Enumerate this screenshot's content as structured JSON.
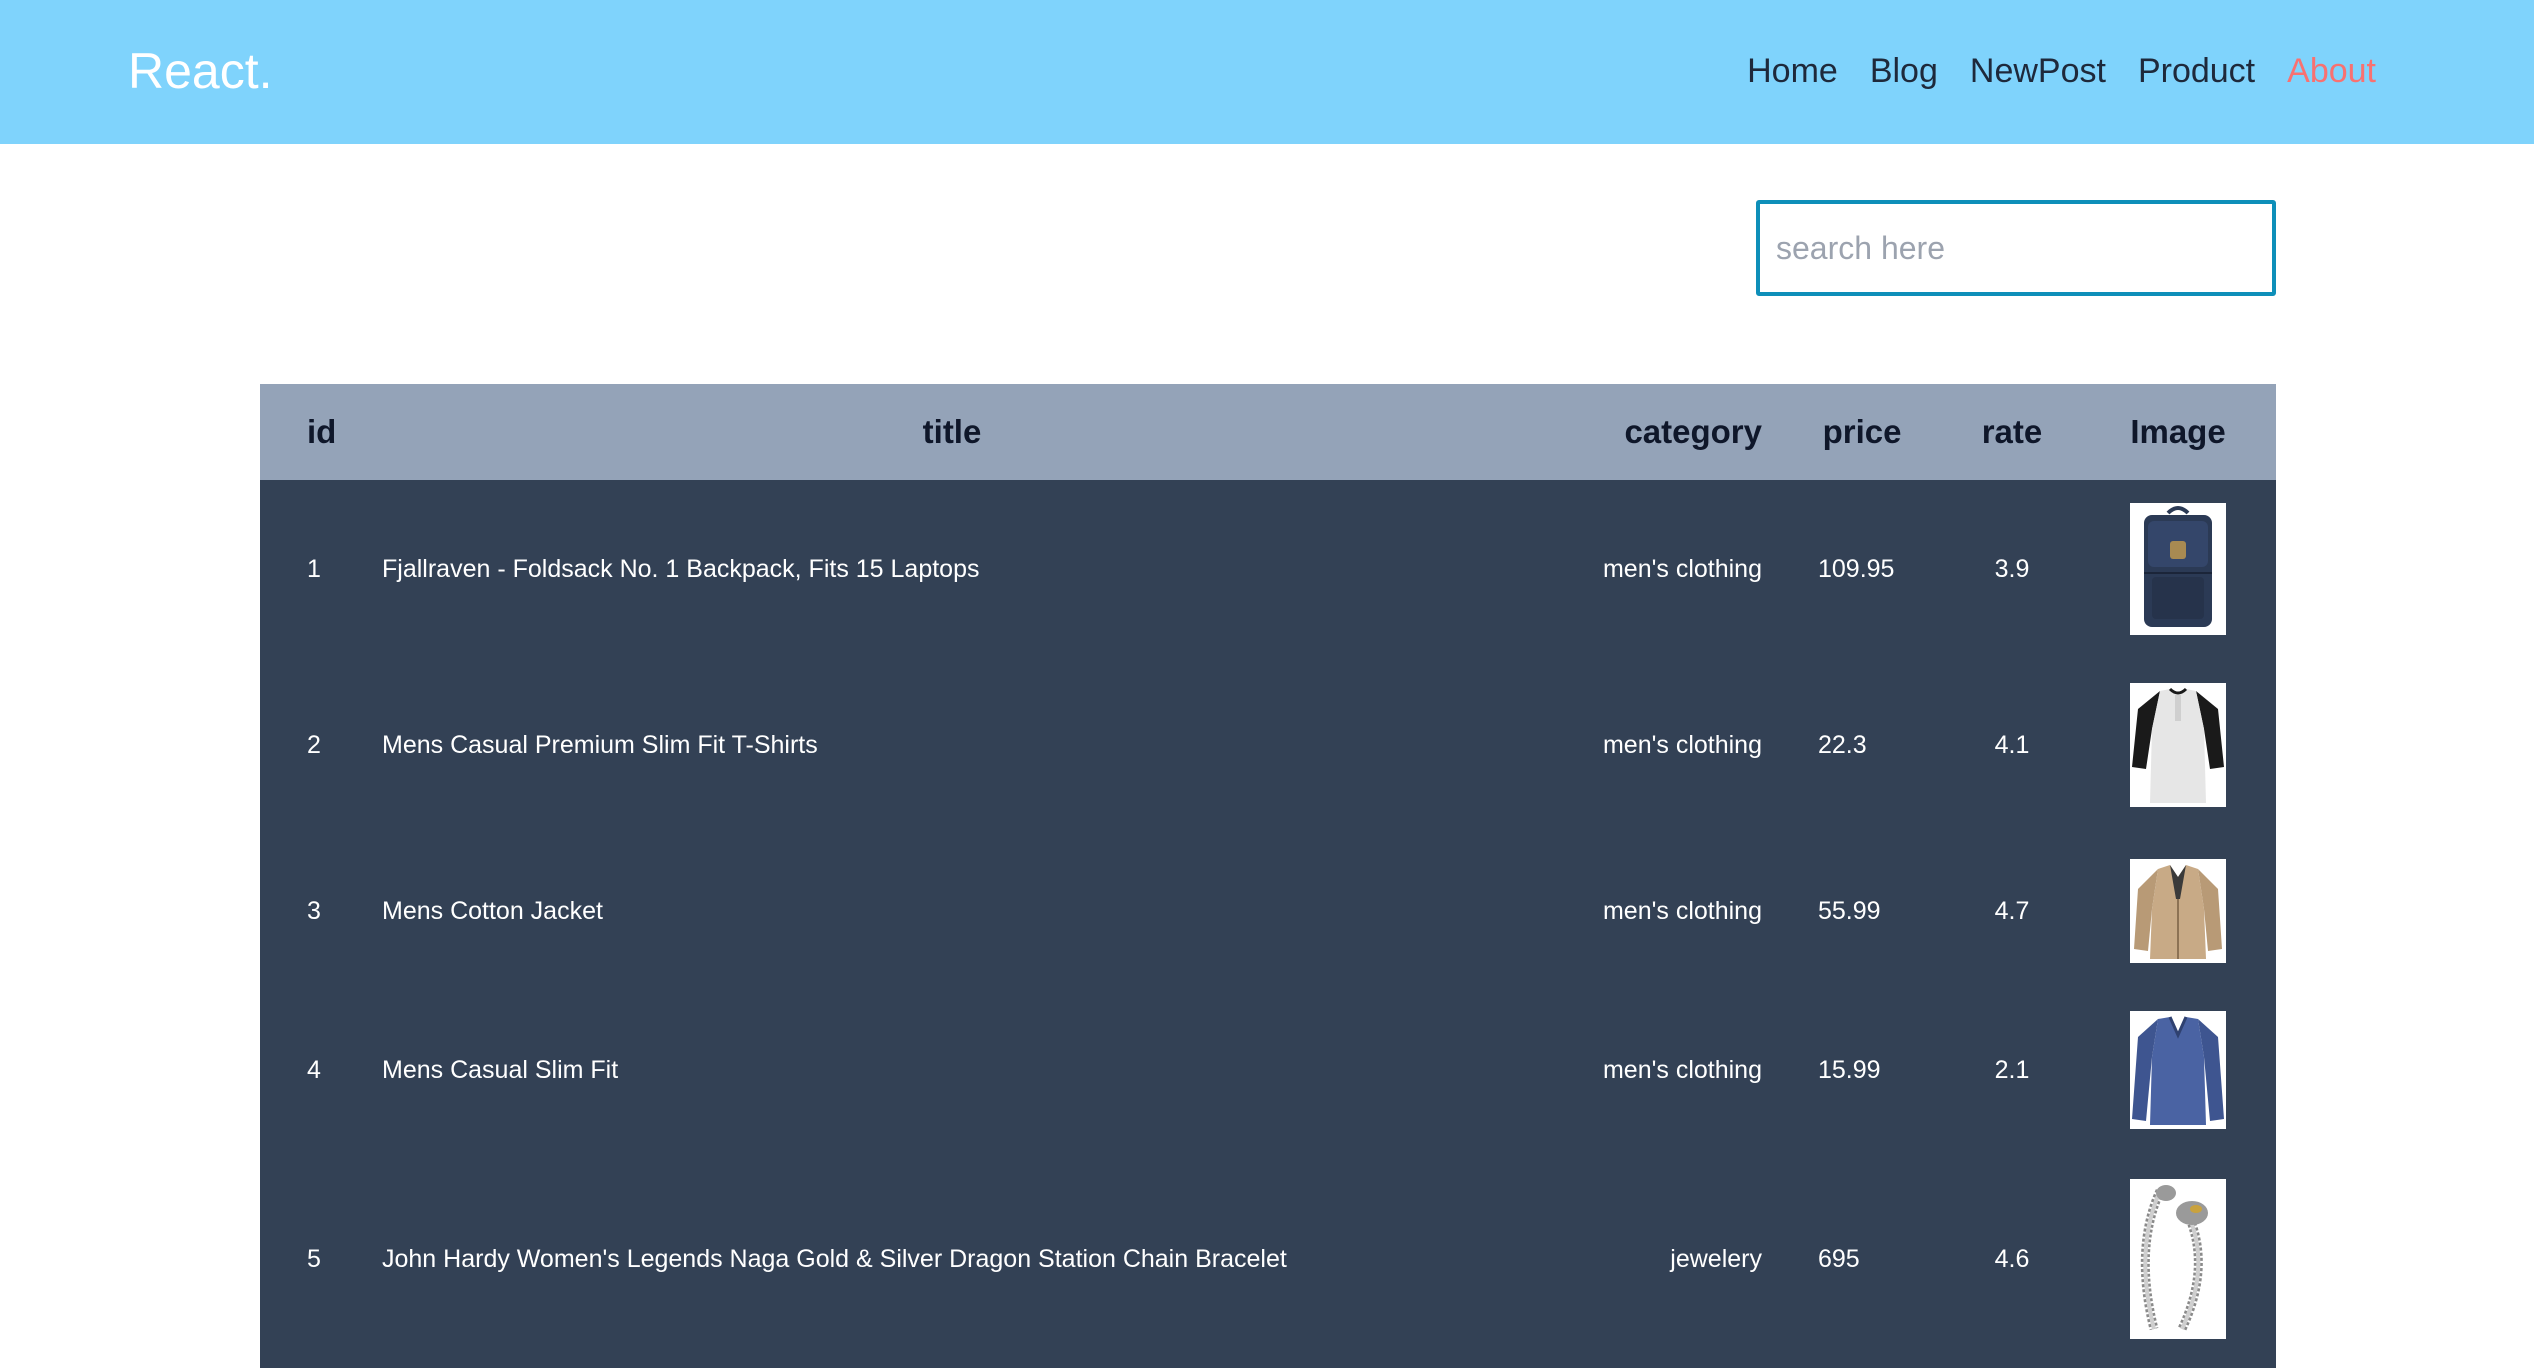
{
  "header": {
    "brand": "React.",
    "nav": [
      {
        "label": "Home"
      },
      {
        "label": "Blog"
      },
      {
        "label": "NewPost"
      },
      {
        "label": "Product"
      },
      {
        "label": "About",
        "active": true
      }
    ],
    "colors": {
      "bar": "#7fd3fc",
      "active_link": "#f87171",
      "link": "#1e293b"
    }
  },
  "search": {
    "placeholder": "search here",
    "value": "",
    "border_color": "#0e8fb9"
  },
  "table": {
    "columns": [
      "id",
      "title",
      "category",
      "price",
      "rate",
      "Image"
    ],
    "colors": {
      "header_bg": "#94a3b8",
      "body_bg": "#334155"
    },
    "rows": [
      {
        "id": "1",
        "title": "Fjallraven - Foldsack No. 1 Backpack, Fits 15 Laptops",
        "category": "men's clothing",
        "price": "109.95",
        "rate": "3.9",
        "image": "backpack-thumbnail"
      },
      {
        "id": "2",
        "title": "Mens Casual Premium Slim Fit T-Shirts",
        "category": "men's clothing",
        "price": "22.3",
        "rate": "4.1",
        "image": "raglan-tshirt-thumbnail"
      },
      {
        "id": "3",
        "title": "Mens Cotton Jacket",
        "category": "men's clothing",
        "price": "55.99",
        "rate": "4.7",
        "image": "cotton-jacket-thumbnail"
      },
      {
        "id": "4",
        "title": "Mens Casual Slim Fit",
        "category": "men's clothing",
        "price": "15.99",
        "rate": "2.1",
        "image": "long-sleeve-shirt-thumbnail"
      },
      {
        "id": "5",
        "title": "John Hardy Women's Legends Naga Gold & Silver Dragon Station Chain Bracelet",
        "category": "jewelery",
        "price": "695",
        "rate": "4.6",
        "image": "dragon-bracelet-thumbnail"
      }
    ]
  }
}
